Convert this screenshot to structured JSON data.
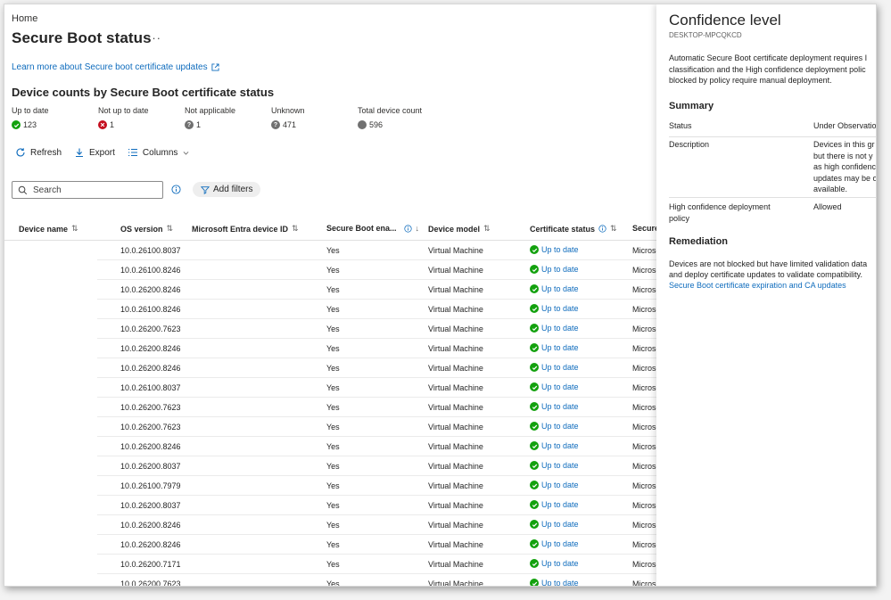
{
  "breadcrumb": "Home",
  "page_title": "Secure Boot status",
  "more_label": "···",
  "learn_link": "Learn more about Secure boot certificate updates",
  "section_heading": "Device counts by Secure Boot certificate status",
  "stats": [
    {
      "label": "Up to date",
      "value": "123",
      "icon": "check-circle-icon",
      "color": "#13a10e"
    },
    {
      "label": "Not up to date",
      "value": "1",
      "icon": "error-circle-icon",
      "color": "#c50f1f"
    },
    {
      "label": "Not applicable",
      "value": "1",
      "icon": "question-circle-icon",
      "color": "#707070"
    },
    {
      "label": "Unknown",
      "value": "471",
      "icon": "question-circle-icon",
      "color": "#707070"
    },
    {
      "label": "Total device count",
      "value": "596",
      "icon": "total-circle-icon",
      "color": "#707070"
    }
  ],
  "toolbar": {
    "refresh": "Refresh",
    "export": "Export",
    "columns": "Columns"
  },
  "search": {
    "placeholder": "Search"
  },
  "add_filters": "Add filters",
  "columns": {
    "device_name": "Device name",
    "os_version": "OS version",
    "entra_id": "Microsoft Entra device ID",
    "secure_boot": "Secure Boot ena...",
    "device_model": "Device model",
    "cert_status": "Certificate status",
    "secure": "Secure"
  },
  "rows": [
    {
      "os": "10.0.26100.8037",
      "sb": "Yes",
      "model": "Virtual Machine",
      "cert": "Up to date",
      "last": "Microso"
    },
    {
      "os": "10.0.26100.8246",
      "sb": "Yes",
      "model": "Virtual Machine",
      "cert": "Up to date",
      "last": "Microso"
    },
    {
      "os": "10.0.26200.8246",
      "sb": "Yes",
      "model": "Virtual Machine",
      "cert": "Up to date",
      "last": "Microso"
    },
    {
      "os": "10.0.26100.8246",
      "sb": "Yes",
      "model": "Virtual Machine",
      "cert": "Up to date",
      "last": "Microso"
    },
    {
      "os": "10.0.26200.7623",
      "sb": "Yes",
      "model": "Virtual Machine",
      "cert": "Up to date",
      "last": "Microso"
    },
    {
      "os": "10.0.26200.8246",
      "sb": "Yes",
      "model": "Virtual Machine",
      "cert": "Up to date",
      "last": "Microso"
    },
    {
      "os": "10.0.26200.8246",
      "sb": "Yes",
      "model": "Virtual Machine",
      "cert": "Up to date",
      "last": "Microso"
    },
    {
      "os": "10.0.26100.8037",
      "sb": "Yes",
      "model": "Virtual Machine",
      "cert": "Up to date",
      "last": "Microso"
    },
    {
      "os": "10.0.26200.7623",
      "sb": "Yes",
      "model": "Virtual Machine",
      "cert": "Up to date",
      "last": "Microso"
    },
    {
      "os": "10.0.26200.7623",
      "sb": "Yes",
      "model": "Virtual Machine",
      "cert": "Up to date",
      "last": "Microso"
    },
    {
      "os": "10.0.26200.8246",
      "sb": "Yes",
      "model": "Virtual Machine",
      "cert": "Up to date",
      "last": "Microso"
    },
    {
      "os": "10.0.26200.8037",
      "sb": "Yes",
      "model": "Virtual Machine",
      "cert": "Up to date",
      "last": "Microso"
    },
    {
      "os": "10.0.26100.7979",
      "sb": "Yes",
      "model": "Virtual Machine",
      "cert": "Up to date",
      "last": "Microso"
    },
    {
      "os": "10.0.26200.8037",
      "sb": "Yes",
      "model": "Virtual Machine",
      "cert": "Up to date",
      "last": "Microso"
    },
    {
      "os": "10.0.26200.8246",
      "sb": "Yes",
      "model": "Virtual Machine",
      "cert": "Up to date",
      "last": "Microso"
    },
    {
      "os": "10.0.26200.8246",
      "sb": "Yes",
      "model": "Virtual Machine",
      "cert": "Up to date",
      "last": "Microso"
    },
    {
      "os": "10.0.26200.7171",
      "sb": "Yes",
      "model": "Virtual Machine",
      "cert": "Up to date",
      "last": "Microso"
    },
    {
      "os": "10.0.26200.7623",
      "sb": "Yes",
      "model": "Virtual Machine",
      "cert": "Up to date",
      "last": "Microso"
    }
  ],
  "panel": {
    "title": "Confidence level",
    "device": "DESKTOP-MPCQKCD",
    "description_lines": [
      "Automatic Secure Boot certificate deployment requires I",
      "classification and the High confidence deployment polic",
      "blocked by policy require manual deployment."
    ],
    "summary_heading": "Summary",
    "status_label": "Status",
    "status_value": "Under Observatio",
    "description_label": "Description",
    "description_value_lines": [
      "Devices in this gr",
      "but there is not y",
      "as high confidenc",
      "updates may be o",
      "available."
    ],
    "hc_label_lines": [
      "High confidence deployment",
      "policy"
    ],
    "hc_value": "Allowed",
    "remediation_heading": "Remediation",
    "remediation_lines": [
      "Devices are not blocked but have limited validation data",
      "and deploy certificate updates to validate compatibility."
    ],
    "remediation_link": "Secure Boot certificate expiration and CA updates"
  },
  "colors": {
    "accent": "#0f6cbd",
    "success": "#13a10e",
    "error": "#c50f1f",
    "neutral": "#707070"
  }
}
